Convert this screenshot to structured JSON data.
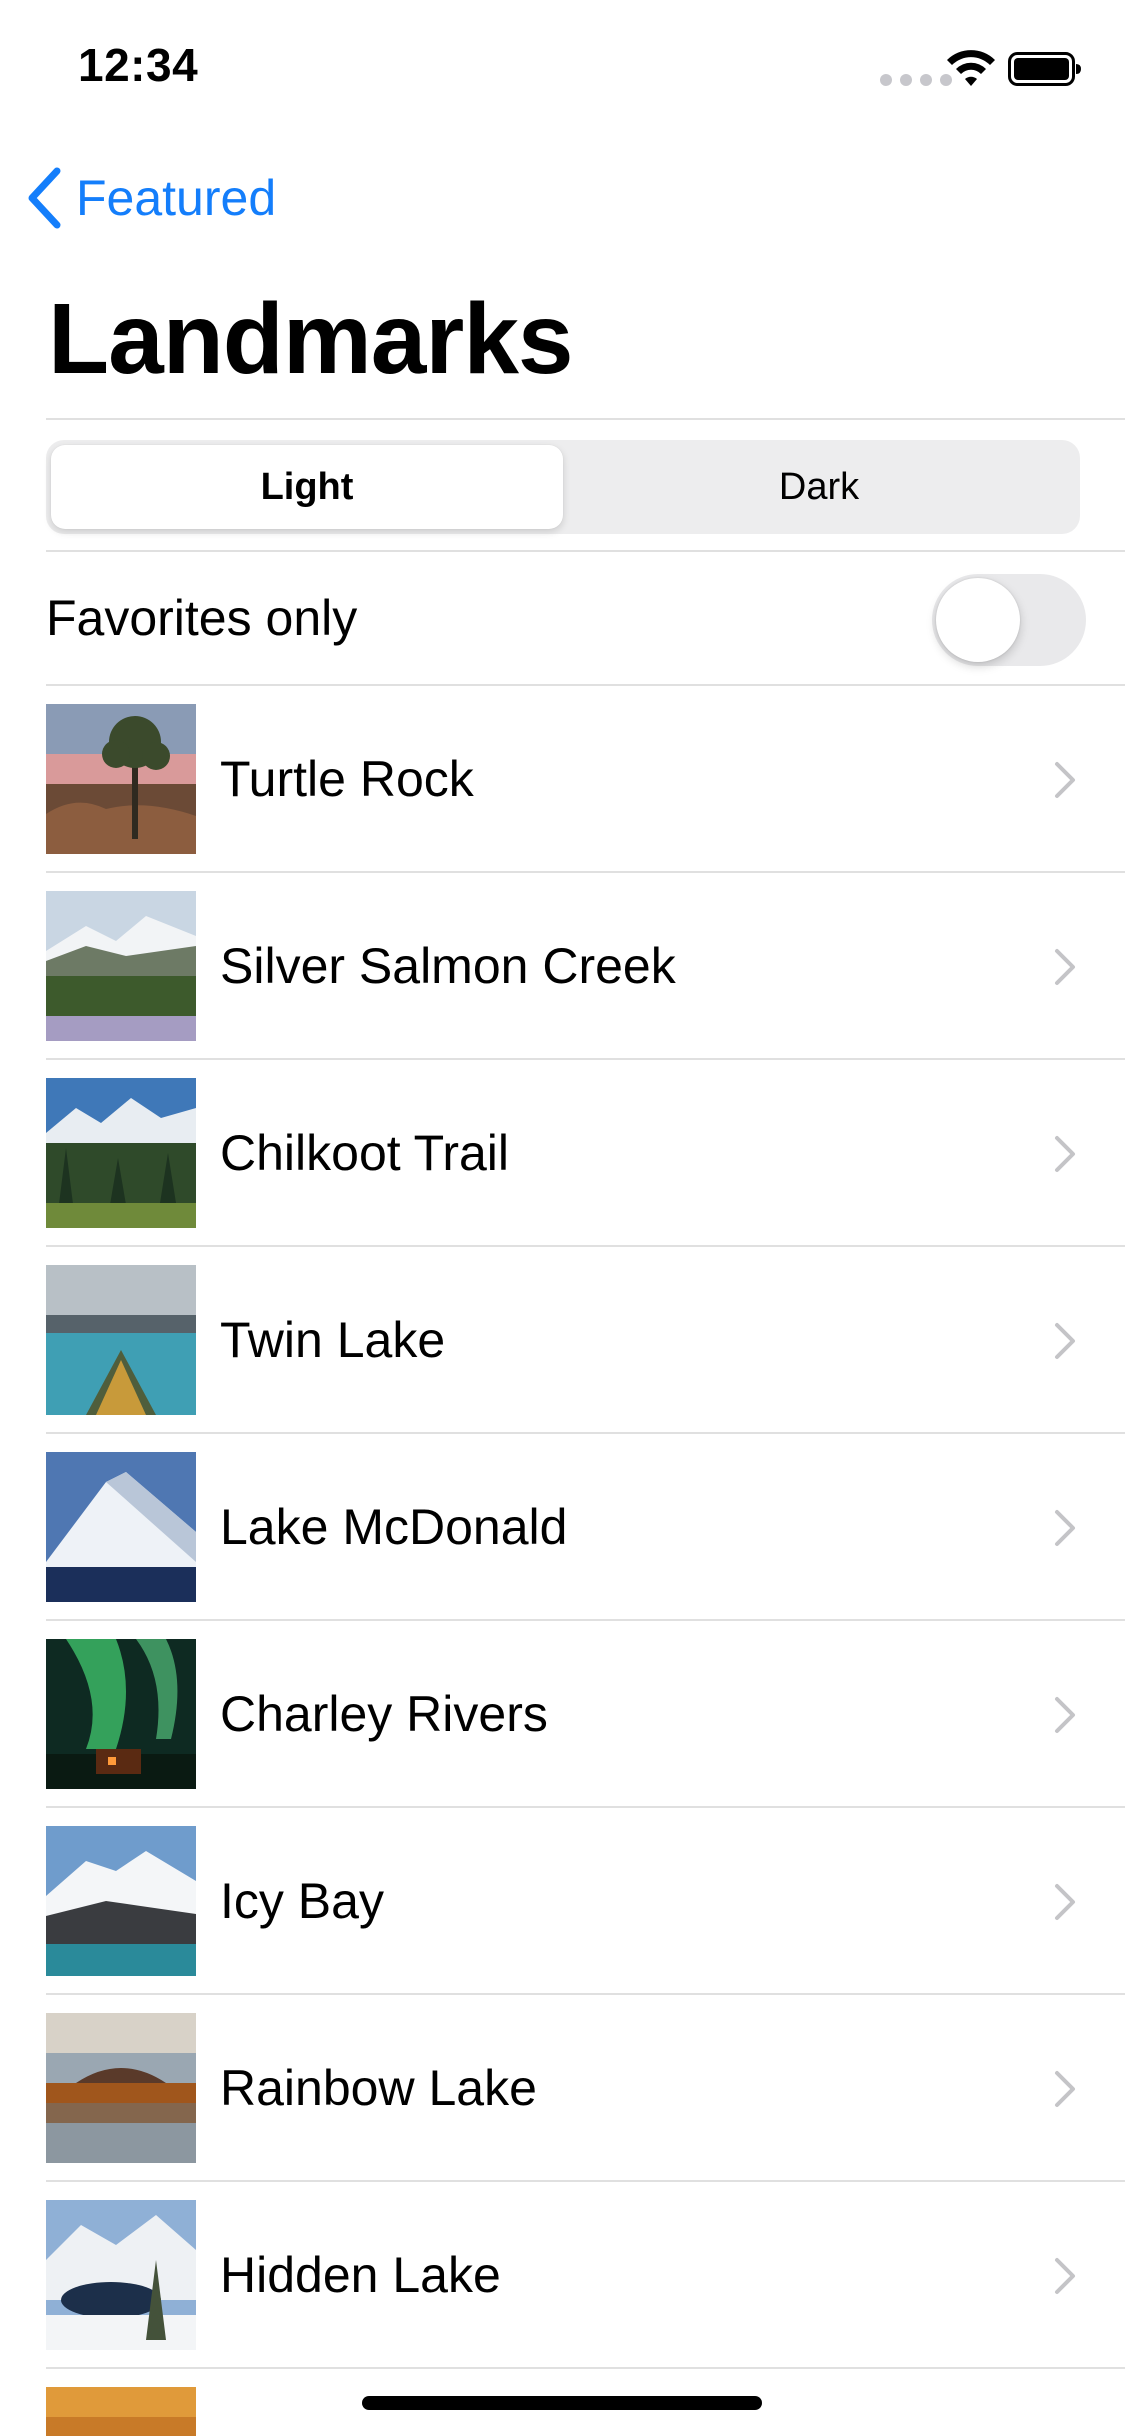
{
  "status_bar": {
    "time": "12:34"
  },
  "nav": {
    "back_label": "Featured",
    "title": "Landmarks"
  },
  "segmented": {
    "options": [
      "Light",
      "Dark"
    ],
    "selected": "Light"
  },
  "favorites": {
    "label": "Favorites only",
    "on": false
  },
  "landmarks": [
    {
      "name": "Turtle Rock"
    },
    {
      "name": "Silver Salmon Creek"
    },
    {
      "name": "Chilkoot Trail"
    },
    {
      "name": "Twin Lake"
    },
    {
      "name": "Lake McDonald"
    },
    {
      "name": "Charley Rivers"
    },
    {
      "name": "Icy Bay"
    },
    {
      "name": "Rainbow Lake"
    },
    {
      "name": "Hidden Lake"
    }
  ],
  "colors": {
    "accent": "#147efb",
    "separator": "#e0e0e0",
    "segment_bg": "#ededee"
  }
}
